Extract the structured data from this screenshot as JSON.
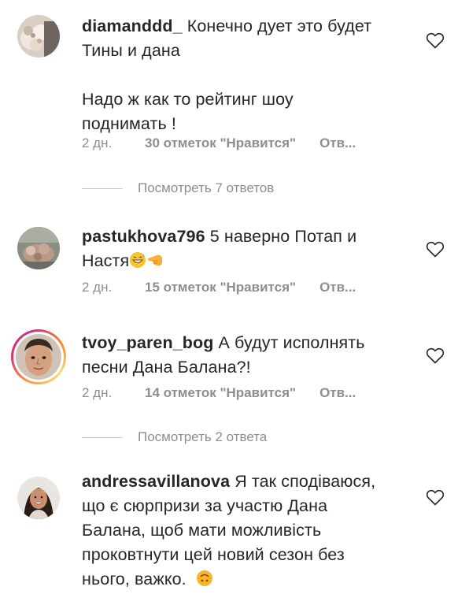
{
  "colors": {
    "text": "#262626",
    "secondary": "#8e8e8e",
    "divider": "#c7c7c7"
  },
  "comments": [
    {
      "username": "diamanddd_",
      "text_line1": "Конечно дует это будет",
      "text_line2": "Тины и дана",
      "text_line3": "Надо ж как то рейтинг шоу",
      "text_line4": "поднимать !",
      "time": "2 дн.",
      "likes": "30 отметок \"Нравится\"",
      "reply": "Отв..."
    },
    {
      "username": "pastukhova796",
      "text_line1": "5 наверно Потап и",
      "text_line2": "Настя",
      "emoji": [
        "grinning-sweat-emoji",
        "backhand-index-pointing-left-emoji"
      ],
      "time": "2 дн.",
      "likes": "15 отметок \"Нравится\"",
      "reply": "Отв..."
    },
    {
      "username": "tvoy_paren_bog",
      "text_line1": "А будут исполнять",
      "text_line2": "песни Дана Балана?!",
      "time": "2 дн.",
      "likes": "14 отметок \"Нравится\"",
      "reply": "Отв..."
    },
    {
      "username": "andressavillanova",
      "text_line1": "Я так сподіваюся,",
      "text_line2": "що є сюрпризи за участю Дана",
      "text_line3": "Балана, щоб мати можливість",
      "text_line4": "проковтнути цей новий сезон без",
      "text_line5": "нього, важко.",
      "emoji": [
        "upside-down-face-emoji"
      ]
    }
  ],
  "view_replies": [
    "Посмотреть 7 ответов",
    "Посмотреть 2 ответа"
  ]
}
